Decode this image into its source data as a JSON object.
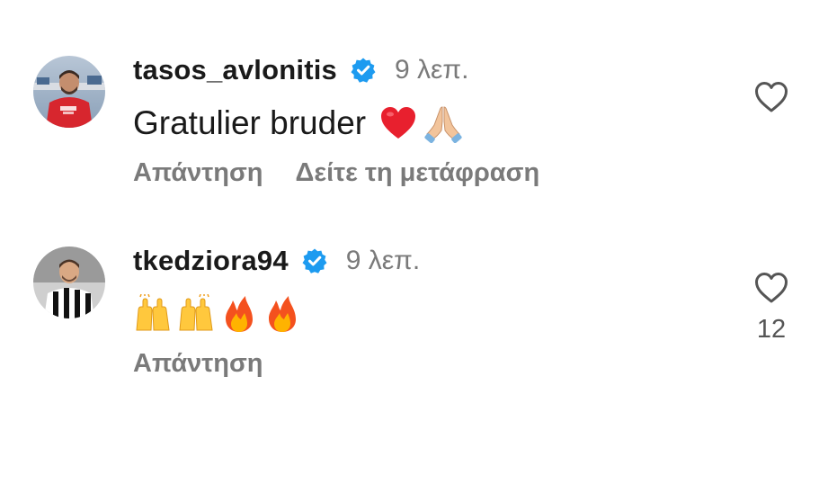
{
  "colors": {
    "text_primary": "#1a1a1a",
    "text_secondary": "#7a7a7a",
    "verified_badge": "#1d9bf0",
    "background": "#ffffff"
  },
  "comments": [
    {
      "username": "tasos_avlonitis",
      "verified": true,
      "time": "9 λεπ.",
      "text": "Gratulier bruder",
      "emojis": [
        "red-heart",
        "folded-hands"
      ],
      "actions": [
        "Απάντηση",
        "Δείτε τη μετάφραση"
      ],
      "like_icon": "heart-outline-icon",
      "like_count": ""
    },
    {
      "username": "tkedziora94",
      "verified": true,
      "time": "9 λεπ.",
      "text": "",
      "emojis": [
        "raising-hands",
        "raising-hands",
        "fire",
        "fire"
      ],
      "actions": [
        "Απάντηση"
      ],
      "like_icon": "heart-outline-icon",
      "like_count": "12"
    }
  ]
}
